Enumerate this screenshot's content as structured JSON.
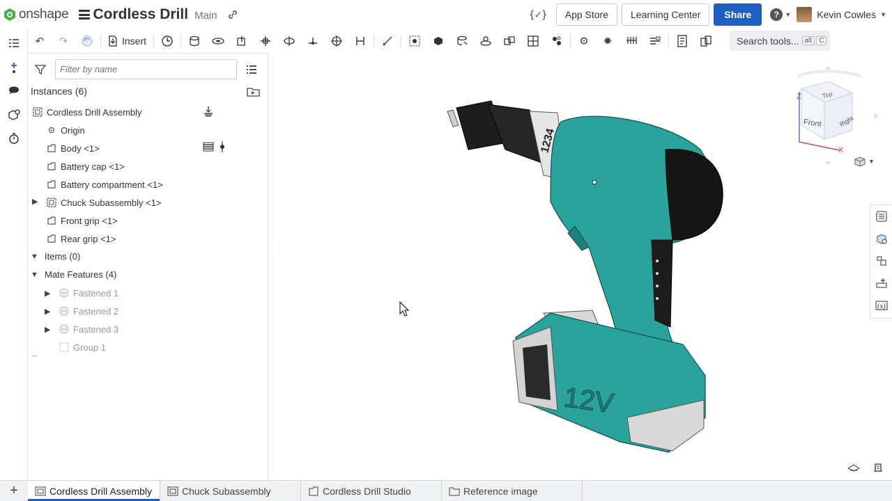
{
  "app": {
    "brand": "onshape",
    "doc_title": "Cordless Drill",
    "branch": "Main"
  },
  "header": {
    "app_store": "App Store",
    "learning_center": "Learning Center",
    "share": "Share",
    "help": "?",
    "user_name": "Kevin Cowles"
  },
  "toolbar": {
    "insert_label": "Insert",
    "search_tools": "Search tools...",
    "shortcut_mod": "alt",
    "shortcut_key": "C"
  },
  "panel": {
    "filter_placeholder": "Filter by name",
    "instances_header": "Instances (6)",
    "tree": [
      {
        "label": "Cordless Drill Assembly"
      },
      {
        "label": "Origin"
      },
      {
        "label": "Body <1>"
      },
      {
        "label": "Battery cap <1>"
      },
      {
        "label": "Battery compartment <1>"
      },
      {
        "label": "Chuck Subassembly <1>"
      },
      {
        "label": "Front grip <1>"
      },
      {
        "label": "Rear grip <1>"
      }
    ],
    "items_header": "Items (0)",
    "mates_header": "Mate Features (4)",
    "mates": [
      {
        "label": "Fastened 1"
      },
      {
        "label": "Fastened 2"
      },
      {
        "label": "Fastened 3"
      },
      {
        "label": "Group 1"
      }
    ]
  },
  "viewcube": {
    "axis_z": "Z",
    "axis_x": "X",
    "face_top": "Top",
    "face_front": "Front",
    "face_right": "Right"
  },
  "model": {
    "battery_label": "12V",
    "chuck_numbers": "1234"
  },
  "tabs": [
    {
      "label": "Cordless Drill Assembly",
      "active": true
    },
    {
      "label": "Chuck Subassembly"
    },
    {
      "label": "Cordless Drill Studio"
    },
    {
      "label": "Reference image"
    }
  ],
  "colors": {
    "accent": "#1f5fbf",
    "drill_teal": "#2aa39c",
    "logo_green": "#4caf50"
  }
}
